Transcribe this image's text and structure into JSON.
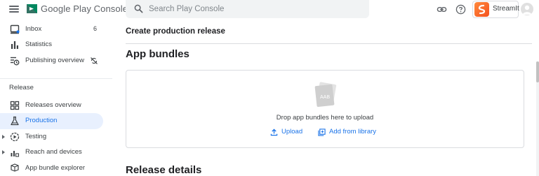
{
  "header": {
    "brand": "Google Play Console",
    "search_placeholder": "Search Play Console",
    "app_name": "StreamIt"
  },
  "sidebar": {
    "items_top": [
      {
        "label": "Inbox",
        "icon": "inbox-icon",
        "badge": "6"
      },
      {
        "label": "Statistics",
        "icon": "bar-chart-icon"
      },
      {
        "label": "Publishing overview",
        "icon": "publishing-overview-icon",
        "trailing_icon": "sync-disabled-icon"
      }
    ],
    "section_label": "Release",
    "items_release": [
      {
        "label": "Releases overview",
        "icon": "releases-overview-icon"
      },
      {
        "label": "Production",
        "icon": "production-icon",
        "active": true
      },
      {
        "label": "Testing",
        "icon": "testing-icon",
        "expandable": true
      },
      {
        "label": "Reach and devices",
        "icon": "reach-devices-icon",
        "expandable": true
      },
      {
        "label": "App bundle explorer",
        "icon": "app-bundle-explorer-icon"
      }
    ]
  },
  "main": {
    "page_title": "Create production release",
    "section_title": "App bundles",
    "upload": {
      "drop_text": "Drop app bundles here to upload",
      "aab_label": "AAB",
      "upload_button": "Upload",
      "add_from_library_button": "Add from library"
    },
    "release_details_title": "Release details"
  },
  "colors": {
    "accent": "#1a73e8",
    "active_nav_bg": "#e8f0fe",
    "app_logo": "#f4511e"
  }
}
